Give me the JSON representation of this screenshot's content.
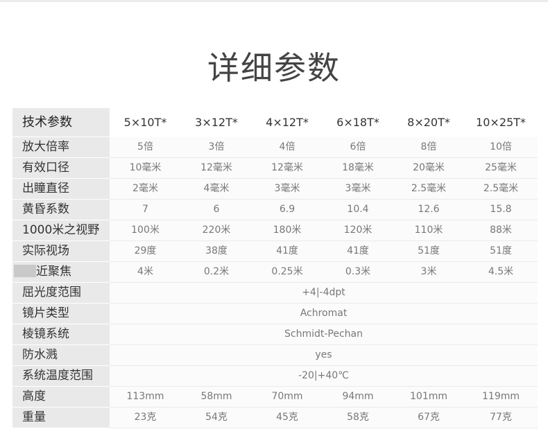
{
  "title": "详细参数",
  "table": {
    "header": [
      "技术参数",
      "5×10T*",
      "3×12T*",
      "4×12T*",
      "6×18T*",
      "8×20T*",
      "10×25T*"
    ],
    "rows": [
      {
        "label": "放大倍率",
        "values": [
          "5倍",
          "3倍",
          "4倍",
          "6倍",
          "8倍",
          "10倍"
        ]
      },
      {
        "label": "有效口径",
        "values": [
          "10毫米",
          "12毫米",
          "12毫米",
          "18毫米",
          "20毫米",
          "25毫米"
        ]
      },
      {
        "label": "出瞳直径",
        "values": [
          "2毫米",
          "4毫米",
          "3毫米",
          "3毫米",
          "2.5毫米",
          "2.5毫米"
        ]
      },
      {
        "label": "黄昏系数",
        "values": [
          "7",
          "6",
          "6.9",
          "10.4",
          "12.6",
          "15.8"
        ]
      },
      {
        "label": "1000米之视野",
        "values": [
          "100米",
          "220米",
          "180米",
          "120米",
          "110米",
          "88米"
        ]
      },
      {
        "label": "实际视场",
        "values": [
          "29度",
          "38度",
          "41度",
          "41度",
          "51度",
          "51度"
        ]
      },
      {
        "label": "近聚焦",
        "values": [
          "4米",
          "0.2米",
          "0.25米",
          "0.3米",
          "3米",
          "4.5米"
        ]
      },
      {
        "label": "屈光度范围",
        "span_value": "+4|-4dpt"
      },
      {
        "label": "镜片类型",
        "span_value": "Achromat"
      },
      {
        "label": "棱镜系统",
        "span_value": "Schmidt-Pechan"
      },
      {
        "label": "防水溅",
        "span_value": "yes"
      },
      {
        "label": "系统温度范围",
        "span_value": "-20|+40℃"
      },
      {
        "label": "高度",
        "values": [
          "113mm",
          "58mm",
          "70mm",
          "94mm",
          "101mm",
          "119mm"
        ]
      },
      {
        "label": "重量",
        "values": [
          "23克",
          "54克",
          "45克",
          "58克",
          "67克",
          "77克"
        ]
      }
    ]
  }
}
